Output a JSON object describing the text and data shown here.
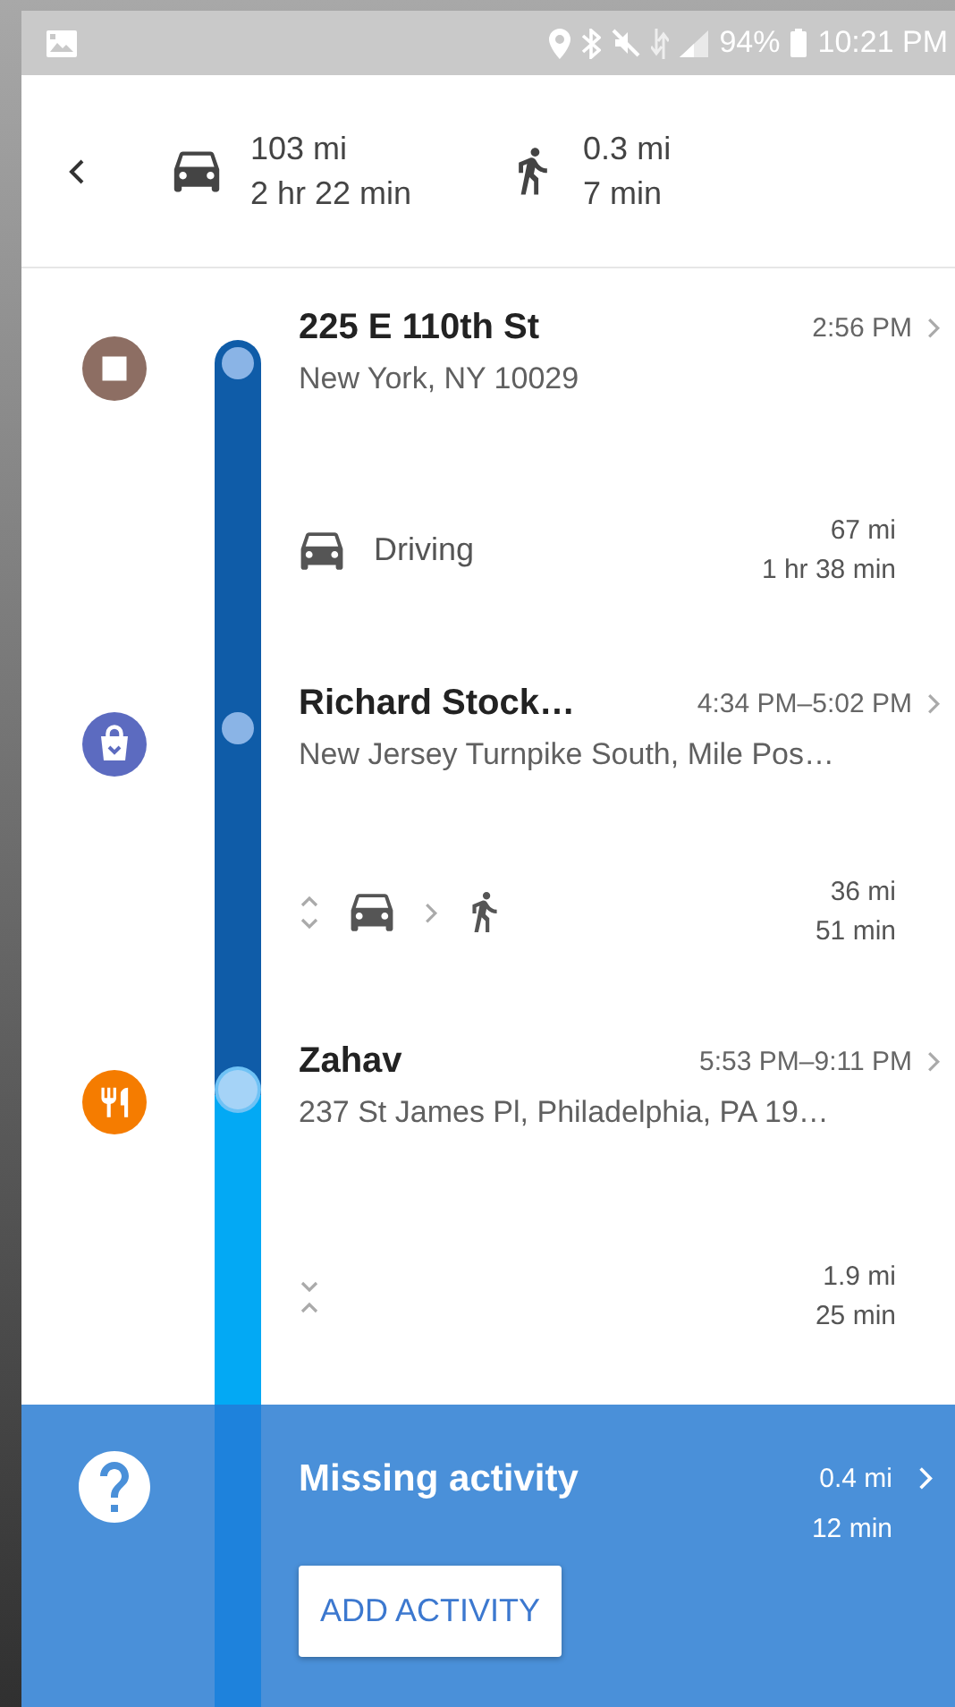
{
  "status_bar": {
    "battery": "94%",
    "time": "10:21 PM"
  },
  "summary": {
    "driving": {
      "distance": "103 mi",
      "duration": "2 hr 22 min"
    },
    "walking": {
      "distance": "0.3 mi",
      "duration": "7 min"
    }
  },
  "timeline": [
    {
      "kind": "stop",
      "name": "225 E 110th St",
      "time": "2:56 PM",
      "address": "New York, NY 10029",
      "color": "#8d6e63",
      "selected": false
    },
    {
      "kind": "travel_single",
      "label": "Driving",
      "distance": "67 mi",
      "duration": "1 hr 38 min"
    },
    {
      "kind": "shopping",
      "name": "Richard Stock…",
      "time": "4:34 PM–5:02 PM",
      "address": "New Jersey Turnpike South, Mile Pos…",
      "color": "#5c6bc0",
      "selected": false
    },
    {
      "kind": "travel_multi",
      "distance": "36 mi",
      "duration": "51 min"
    },
    {
      "kind": "restaurant",
      "name": "Zahav",
      "time": "5:53 PM–9:11 PM",
      "address": "237 St James Pl, Philadelphia, PA 19…",
      "color": "#f57c00",
      "selected": true
    },
    {
      "kind": "travel_collapsed",
      "distance": "1.9 mi",
      "duration": "25 min"
    }
  ],
  "missing": {
    "title": "Missing activity",
    "distance": "0.4 mi",
    "duration": "12 min",
    "button": "ADD ACTIVITY"
  }
}
